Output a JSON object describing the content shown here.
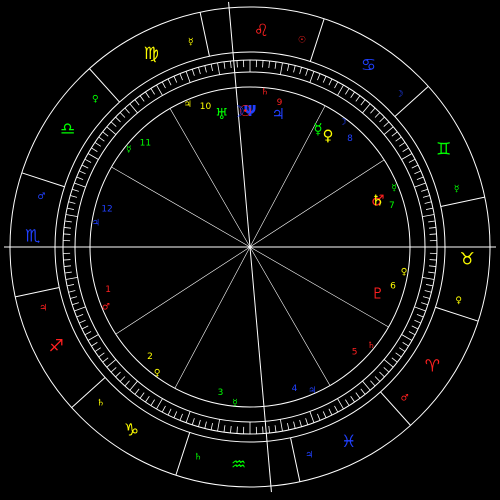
{
  "colors": {
    "background": "#000000",
    "lines": "#ffffff",
    "fire": "#ff2020",
    "earth": "#ffff00",
    "air": "#00ff00",
    "water": "#2040ff"
  },
  "signs": [
    {
      "symbol": "♐",
      "name": "sagittarius",
      "color": "#ff2020"
    },
    {
      "symbol": "♑",
      "name": "capricorn",
      "color": "#ffff00"
    },
    {
      "symbol": "♒",
      "name": "aquarius",
      "color": "#00ff00"
    },
    {
      "symbol": "♓",
      "name": "pisces",
      "color": "#2040ff"
    },
    {
      "symbol": "♈",
      "name": "aries",
      "color": "#ff2020"
    },
    {
      "symbol": "♉",
      "name": "taurus",
      "color": "#ffff00"
    },
    {
      "symbol": "♊",
      "name": "gemini",
      "color": "#00ff00"
    },
    {
      "symbol": "♋",
      "name": "cancer",
      "color": "#2040ff"
    },
    {
      "symbol": "♌",
      "name": "leo",
      "color": "#ff2020"
    },
    {
      "symbol": "♍",
      "name": "virgo",
      "color": "#ffff00"
    },
    {
      "symbol": "♎",
      "name": "libra",
      "color": "#00ff00"
    },
    {
      "symbol": "♏",
      "name": "scorpio",
      "color": "#2040ff"
    }
  ],
  "houses": [
    "1",
    "2",
    "3",
    "4",
    "5",
    "6",
    "7",
    "8",
    "9",
    "10",
    "11",
    "12"
  ],
  "ruler_marks": [
    {
      "symbol": "♃",
      "color": "#ff2020"
    },
    {
      "symbol": "♄",
      "color": "#ffff00"
    },
    {
      "symbol": "♄",
      "color": "#00ff00"
    },
    {
      "symbol": "♃",
      "color": "#2040ff"
    },
    {
      "symbol": "♂",
      "color": "#ff2020"
    },
    {
      "symbol": "♀",
      "color": "#ffff00"
    },
    {
      "symbol": "☿",
      "color": "#00ff00"
    },
    {
      "symbol": "☽",
      "color": "#2040ff"
    },
    {
      "symbol": "☉",
      "color": "#ff2020"
    },
    {
      "symbol": "☿",
      "color": "#ffff00"
    },
    {
      "symbol": "♀",
      "color": "#00ff00"
    },
    {
      "symbol": "♂",
      "color": "#2040ff"
    }
  ],
  "planets": [
    {
      "symbol": "♂",
      "name": "mars",
      "color": "#ff2020"
    },
    {
      "symbol": "♀",
      "name": "venus",
      "color": "#ffff00"
    },
    {
      "symbol": "☿",
      "name": "mercury",
      "color": "#00ff00"
    },
    {
      "symbol": "♃",
      "name": "jupiter",
      "color": "#2040ff"
    },
    {
      "symbol": "♄",
      "name": "saturn",
      "color": "#ffff00"
    },
    {
      "symbol": "Ψ",
      "name": "neptune",
      "color": "#2040ff"
    },
    {
      "symbol": "☉",
      "name": "sun",
      "color": "#ff2020"
    },
    {
      "symbol": "☽",
      "name": "moon",
      "color": "#2040ff"
    },
    {
      "symbol": "♅",
      "name": "uranus",
      "color": "#00ff00"
    },
    {
      "symbol": "♇",
      "name": "pluto",
      "color": "#ff2020"
    }
  ],
  "house_planets": [
    {
      "symbol": "♂",
      "color": "#ff2020"
    },
    {
      "symbol": "♀",
      "color": "#ffff00"
    },
    {
      "symbol": "☿",
      "color": "#00ff00"
    },
    {
      "symbol": "♃",
      "color": "#2040ff"
    },
    {
      "symbol": "♄",
      "color": "#ff2020"
    },
    {
      "symbol": "♀",
      "color": "#ffff00"
    },
    {
      "symbol": "☿",
      "color": "#00ff00"
    },
    {
      "symbol": "☽",
      "color": "#2040ff"
    },
    {
      "symbol": "♄",
      "color": "#ff2020"
    },
    {
      "symbol": "♃",
      "color": "#ffff00"
    },
    {
      "symbol": "☿",
      "color": "#00ff00"
    },
    {
      "symbol": "♃",
      "color": "#2040ff"
    }
  ]
}
